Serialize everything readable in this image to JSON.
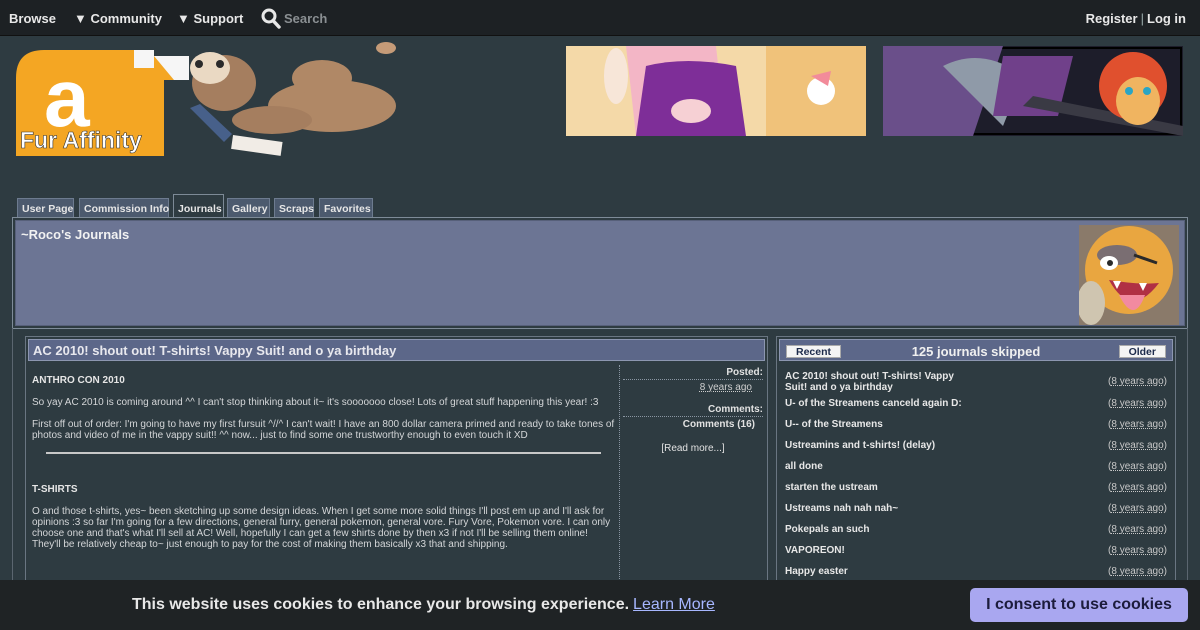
{
  "topnav": {
    "browse": "Browse",
    "community": "▼ Community",
    "support": "▼ Support",
    "search_placeholder": "Search",
    "register": "Register",
    "separator": "|",
    "login": "Log in"
  },
  "logo": {
    "text": "Fur Affinity",
    "letter": "a"
  },
  "tabs": [
    {
      "label": "User Page"
    },
    {
      "label": "Commission Info"
    },
    {
      "label": "Journals"
    },
    {
      "label": "Gallery"
    },
    {
      "label": "Scraps"
    },
    {
      "label": "Favorites"
    }
  ],
  "journal_header": {
    "title": "~Roco's Journals"
  },
  "post": {
    "title": "AC 2010! shout out! T-shirts! Vappy Suit! and o ya birthday",
    "h1": "ANTHRO CON 2010",
    "p1": "So yay AC 2010 is coming around ^^ I can't stop thinking about it~ it's sooooooo close! Lots of great stuff happening this year! :3",
    "p2": "First off out of order: I'm going to have my first fursuit ^//^ I can't wait! I have an 800 dollar camera primed and ready to take tones of photos and video of me in the vappy suit!! ^^ now... just to find some one trustworthy enough to even touch it XD",
    "h2": "T-SHIRTS",
    "p3": "O and those t-shirts, yes~ been sketching up some design ideas. When I get some more solid things I'll post em up and I'll ask for opinions :3 so far I'm going for a few directions, general furry, general pokemon, general vore. Fury Vore, Pokemon vore. I can only choose one and that's what I'll sell at AC! Well, hopefully I can get a few shirts done by then x3 if not I'll be selling them online! They'll be relatively cheap to~ just enough to pay for the cost of making them basically x3 that and shipping.",
    "posted_label": "Posted:",
    "posted_value": "8 years ago",
    "comments_label": "Comments:",
    "comments_value": "Comments (16)",
    "read_more": "[Read more...]"
  },
  "journal_list": {
    "recent": "Recent",
    "skipped": "125 journals skipped",
    "older": "Older",
    "entries": [
      {
        "title": "AC 2010! shout out! T-shirts! Vappy Suit! and o ya birthday",
        "age": "8 years ago"
      },
      {
        "title": "U- of the Streamens canceld again D:",
        "age": "8 years ago"
      },
      {
        "title": "U-- of the Streamens",
        "age": "8 years ago"
      },
      {
        "title": "Ustreamins and t-shirts! (delay)",
        "age": "8 years ago"
      },
      {
        "title": "all done",
        "age": "8 years ago"
      },
      {
        "title": "starten the ustream",
        "age": "8 years ago"
      },
      {
        "title": "Ustreams nah nah nah~",
        "age": "8 years ago"
      },
      {
        "title": "Pokepals an such",
        "age": "8 years ago"
      },
      {
        "title": "VAPOREON!",
        "age": "8 years ago"
      },
      {
        "title": "Happy easter",
        "age": "8 years ago"
      }
    ]
  },
  "cookie": {
    "message": "This website uses cookies to enhance your browsing experience.",
    "learn_more": "Learn More",
    "consent": "I consent to use cookies"
  }
}
